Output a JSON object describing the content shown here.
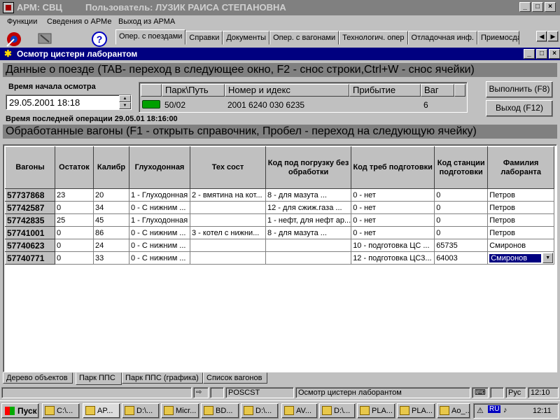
{
  "window": {
    "app_title": "АРМ: СВЦ",
    "user_label": "Пользователь: ЛУЗИК РАИСА СТЕПАНОВНА",
    "min": "_",
    "max": "□",
    "close": "×"
  },
  "menu": [
    "Функции",
    "Сведения о АРМе",
    "Выход из АРМА"
  ],
  "toolbar": {
    "help_label": "?"
  },
  "tabs": [
    {
      "label": "Опер. с поездами",
      "active": true
    },
    {
      "label": "Справки"
    },
    {
      "label": "Документы"
    },
    {
      "label": "Опер. с вагонами"
    },
    {
      "label": "Технологич. опер"
    },
    {
      "label": "Отладочная инф."
    },
    {
      "label": "Приемосда"
    }
  ],
  "inner_window": {
    "title": "Осмотр цистерн лаборантом"
  },
  "train_section": {
    "heading": "Данные о поезде (TAB- переход в следующее окно, F2 - снос строки,Ctrl+W - снос ячейки)",
    "start_time_label": "Время начала осмотра",
    "start_time_value": "29.05.2001  18:18",
    "columns": [
      "Парк\\Путь",
      "Номер и идекс",
      "Прибытие",
      "Ваг"
    ],
    "row": {
      "park": "50/02",
      "number": "2001 6240 030 6235",
      "arrival": "",
      "wagons": "6"
    },
    "execute_button": "Выполнить (F8)",
    "exit_button": "Выход (F12)",
    "last_op": "Время последней  операции 29.05.01 18:16:00"
  },
  "wagons_section": {
    "heading": "Обработанные вагоны (F1 - открыть справочник, Пробел -  переход на следующую ячейку)",
    "columns": [
      "Вагоны",
      "Остаток",
      "Калибр",
      "Глуходонная",
      "Тех сост",
      "Код под погрузку без обработки",
      "Код треб подготовки",
      "Код станции подготовки",
      "Фамилия лаборанта"
    ],
    "rows": [
      [
        "57737868",
        "23",
        "20",
        "1 - Глуходонная",
        "2 - вмятина на кот...",
        "8 - для мазута          ...",
        "0 - нет",
        "0",
        "Петров"
      ],
      [
        "57742587",
        "0",
        "34",
        "0 - С нижним ...",
        "",
        "12 - для сжиж.газа      ...",
        "0 - нет",
        "0",
        "Петров"
      ],
      [
        "57742835",
        "25",
        "45",
        "1 - Глуходонная",
        "",
        "1 - нефт, для нефт ар...",
        "0 - нет",
        "0",
        "Петров"
      ],
      [
        "57741001",
        "0",
        "86",
        "0 - С нижним ...",
        "3 - котел с нижни...",
        "8 - для мазута          ...",
        "0 - нет",
        "0",
        "Петров"
      ],
      [
        "57740623",
        "0",
        "24",
        "0 - С нижним ...",
        "",
        "",
        "10 - подготовка ЦС ...",
        "65735",
        "Смиронов"
      ],
      [
        "57740771",
        "0",
        "33",
        "0 - С нижним ...",
        "",
        "",
        "12 - подготовка ЦС3...",
        "64003",
        "Смиронов"
      ]
    ]
  },
  "bottom_tabs": [
    "Дерево объектов",
    "Парк ППС",
    "Парк ППС (графика)",
    "Список вагонов"
  ],
  "status": {
    "code": "POSCST",
    "message": "Осмотр цистерн лаборантом",
    "lang": "Рус",
    "time": "12:10"
  },
  "taskbar": {
    "start": "Пуск",
    "tasks": [
      "C:\\...",
      "AP...",
      "D:\\...",
      "Micr...",
      "BD...",
      "D:\\...",
      "AV...",
      "D:\\...",
      "PLA...",
      "PLA...",
      "Ao_..."
    ],
    "tray_lang": "RU",
    "clock": "12:11"
  }
}
